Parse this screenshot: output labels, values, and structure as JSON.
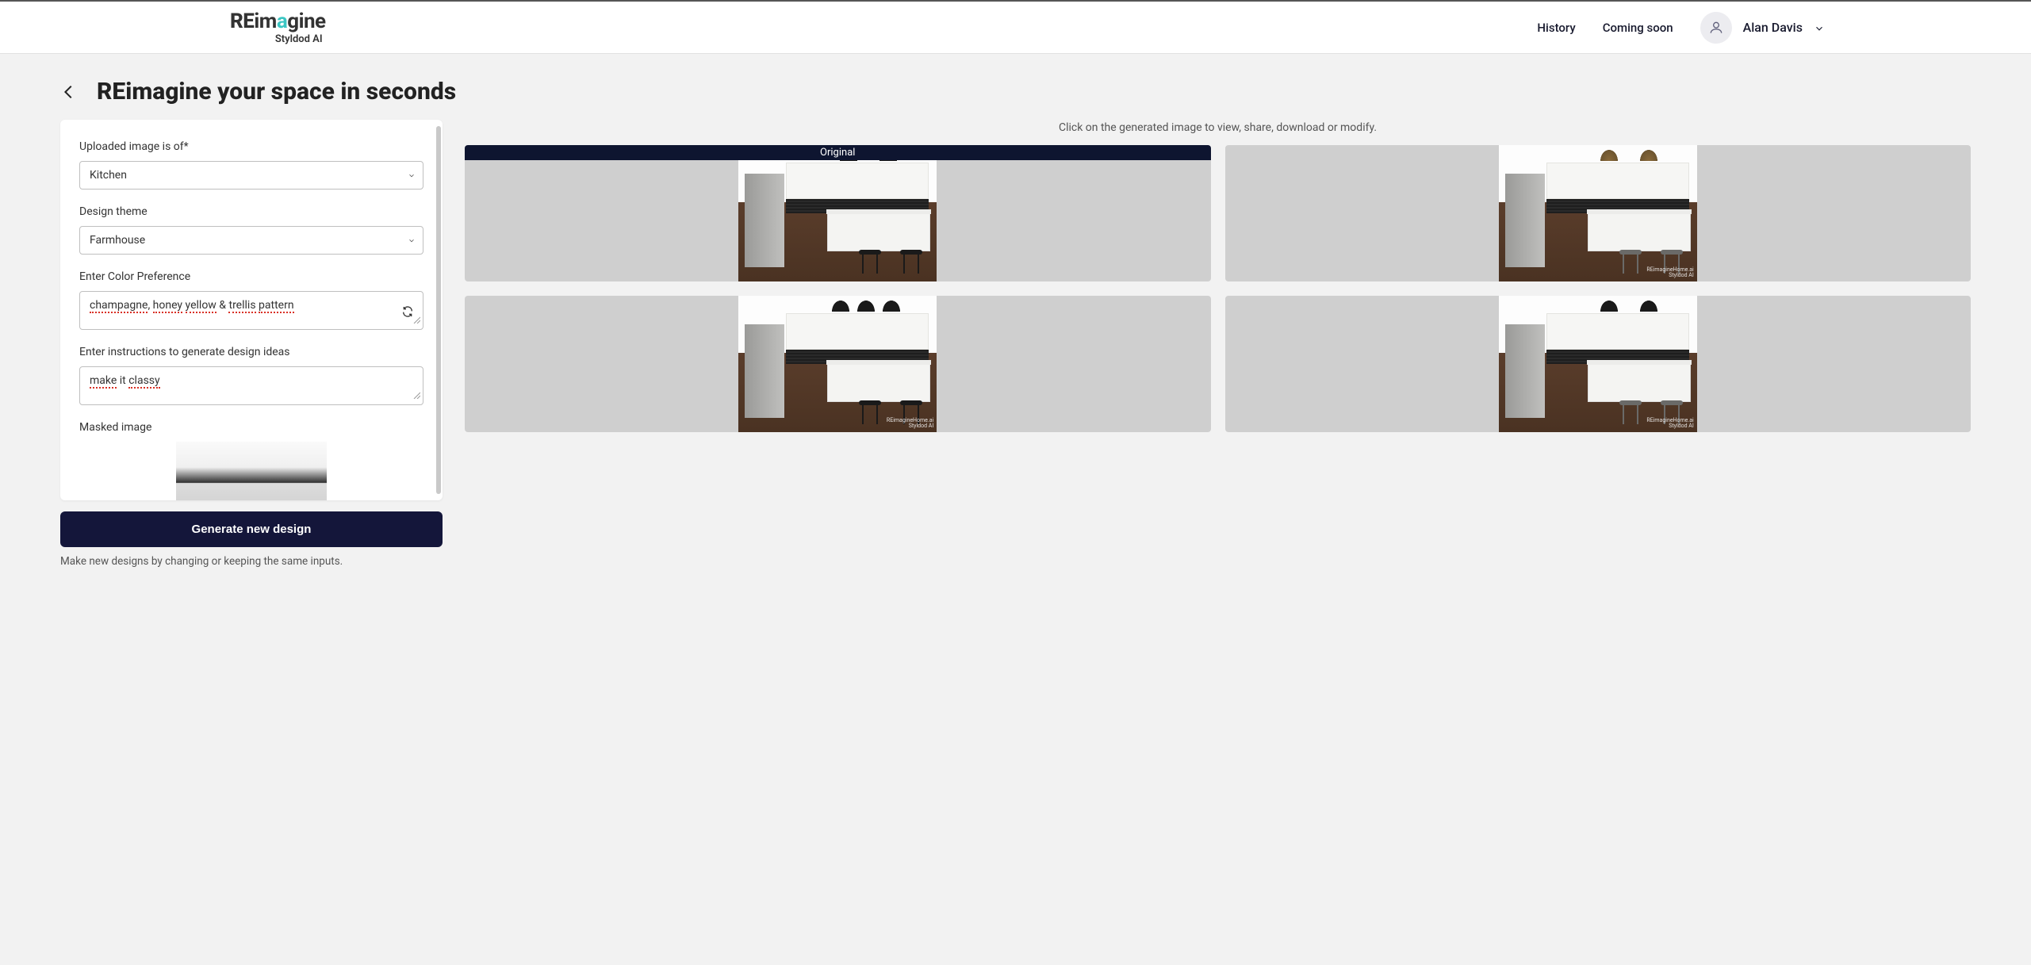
{
  "brand": {
    "prefix": "RE",
    "mid1": "im",
    "a": "a",
    "mid2": "gine",
    "sub": "Styldod AI"
  },
  "nav": {
    "history": "History",
    "coming": "Coming soon"
  },
  "user": {
    "name": "Alan Davis"
  },
  "page": {
    "title": "REimagine your space in seconds"
  },
  "form": {
    "room_label": "Uploaded image is of*",
    "room_value": "Kitchen",
    "theme_label": "Design theme",
    "theme_value": "Farmhouse",
    "color_label": "Enter Color Preference",
    "color_part1": "champagne",
    "color_sep1": ", ",
    "color_part2": "honey",
    "color_sep2": " ",
    "color_part3": "yellow",
    "color_sep3": " & ",
    "color_part4": "trellis",
    "color_sep4": " ",
    "color_part5": "pattern",
    "instr_label": "Enter instructions to generate design ideas",
    "instr_p1": "make",
    "instr_sep1": " it ",
    "instr_p2": "classy",
    "masked_label": "Masked image",
    "generate": "Generate new design",
    "hint": "Make new designs by changing or keeping the same inputs."
  },
  "grid": {
    "hint": "Click on the generated image to view, share, download or modify.",
    "original_label": "Original"
  }
}
